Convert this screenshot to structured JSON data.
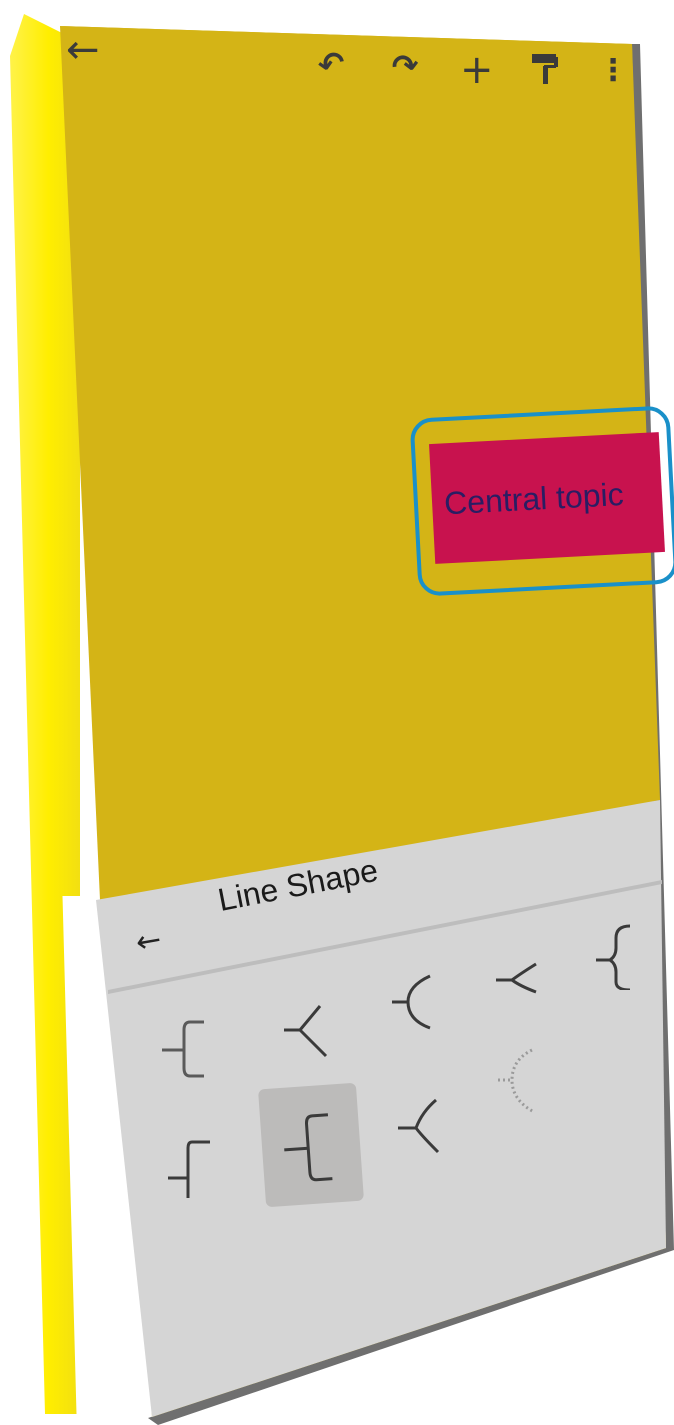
{
  "toolbar": {
    "back_icon": "back-arrow-icon",
    "undo_icon": "undo-icon",
    "redo_icon": "redo-icon",
    "add_icon": "add-icon",
    "format_icon": "paint-roller-icon",
    "more_icon": "more-vertical-icon"
  },
  "canvas": {
    "background_color": "#d4b416",
    "central_topic": {
      "label": "Central topic",
      "fill_color": "#c8124e",
      "text_color": "#2a1d63",
      "selection_color": "#1a90c9"
    }
  },
  "panel": {
    "title": "Line Shape",
    "back_icon": "back-arrow-icon",
    "background_color": "#d5d5d5",
    "shapes": [
      {
        "name": "line-shape-brace-right-top",
        "selected": false
      },
      {
        "name": "line-shape-bracket-elbow",
        "selected": false
      },
      {
        "name": "line-shape-y-fork",
        "selected": false
      },
      {
        "name": "line-shape-curve",
        "selected": false
      },
      {
        "name": "line-shape-arrow-fork",
        "selected": false
      },
      {
        "name": "line-shape-brace-curly",
        "selected": false
      },
      {
        "name": "line-shape-bracket-straight",
        "selected": false
      },
      {
        "name": "line-shape-bracket-rounded",
        "selected": true
      },
      {
        "name": "line-shape-fork-simple",
        "selected": false
      },
      {
        "name": "line-shape-curve-dotted",
        "selected": false
      }
    ]
  }
}
